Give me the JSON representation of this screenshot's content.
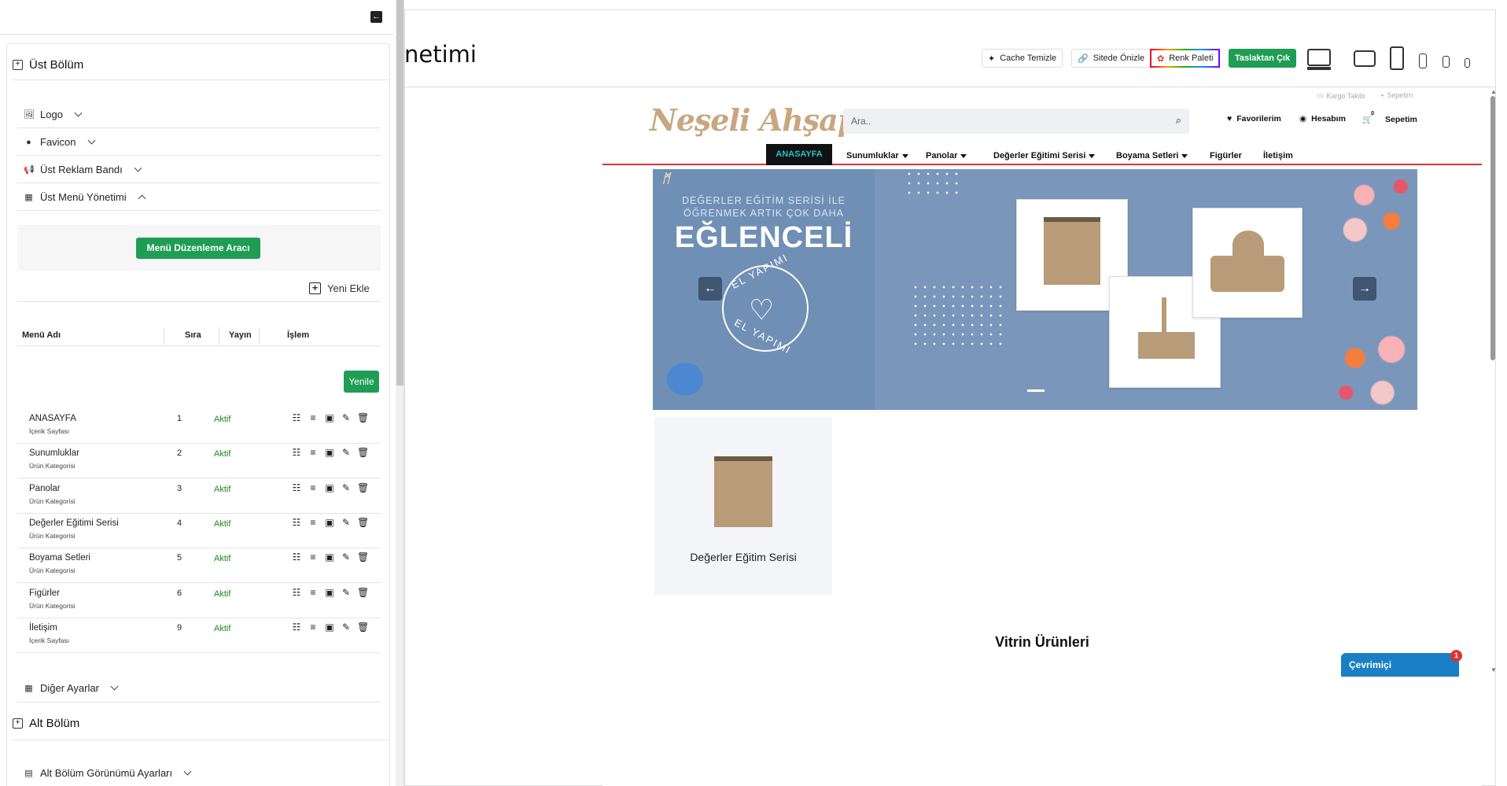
{
  "sidebar": {
    "upper_section": "Üst Bölüm",
    "items": {
      "logo": "Logo",
      "favicon": "Favicon",
      "ad_band": "Üst Reklam Bandı",
      "menu_mgmt": "Üst Menü Yönetimi"
    },
    "menu_tool_btn": "Menü Düzenleme Aracı",
    "add_new": "Yeni Ekle",
    "table_headers": {
      "name": "Menü Adı",
      "order": "Sıra",
      "publish": "Yayın",
      "action": "İşlem"
    },
    "refresh_btn": "Yenile",
    "menu_rows": [
      {
        "name": "ANASAYFA",
        "type": "İçerik Sayfası",
        "order": "1",
        "status": "Aktif"
      },
      {
        "name": "Sunumluklar",
        "type": "Ürün Kategorisi",
        "order": "2",
        "status": "Aktif"
      },
      {
        "name": "Panolar",
        "type": "Ürün Kategorisi",
        "order": "3",
        "status": "Aktif"
      },
      {
        "name": "Değerler Eğitimi Serisi",
        "type": "Ürün Kategorisi",
        "order": "4",
        "status": "Aktif"
      },
      {
        "name": "Boyama Setleri",
        "type": "Ürün Kategorisi",
        "order": "5",
        "status": "Aktif"
      },
      {
        "name": "Figürler",
        "type": "Ürün Kategorisi",
        "order": "6",
        "status": "Aktif"
      },
      {
        "name": "İletişim",
        "type": "İçerik Sayfası",
        "order": "9",
        "status": "Aktif"
      }
    ],
    "other_settings": "Diğer Ayarlar",
    "lower_section": "Alt Bölüm",
    "lower_view": "Alt Bölüm Görünümü Ayarları"
  },
  "main": {
    "title_fragment": "netimi",
    "toolbar": {
      "cache": "Cache Temizle",
      "preview": "Sitede Önizle",
      "palette": "Renk Paleti",
      "draft": "Taslaktan Çık"
    }
  },
  "preview": {
    "top_links": {
      "cargo": "Kargo Takibi",
      "cart_top": "Sepetim"
    },
    "logo_text": "Neşeli Ahşap",
    "search_placeholder": "Ara..",
    "header_links": {
      "fav": "Favorilerim",
      "account": "Hesabım",
      "cart": "Sepetim",
      "cart_count": "0"
    },
    "nav": [
      "ANASAYFA",
      "Sunumluklar",
      "Panolar",
      "Değerler Eğitimi Serisi",
      "Boyama Setleri",
      "Figürler",
      "İletişim"
    ],
    "banner": {
      "line1": "DEĞERLER EĞİTİM SERİSİ İLE",
      "line2": "ÖĞRENMEK ARTIK ÇOK DAHA",
      "title": "EĞLENCELİ",
      "stamp": "EL YAPIMI"
    },
    "category_card": "Değerler Eğitim Serisi",
    "showcase_title": "Vitrin Ürünleri",
    "online_chat": "Çevrimiçi",
    "online_badge": "1"
  },
  "colors": {
    "green": "#1f9d55",
    "accent_cyan": "#21c4d0",
    "banner_blue": "#7a97bb",
    "red": "#d33333"
  }
}
